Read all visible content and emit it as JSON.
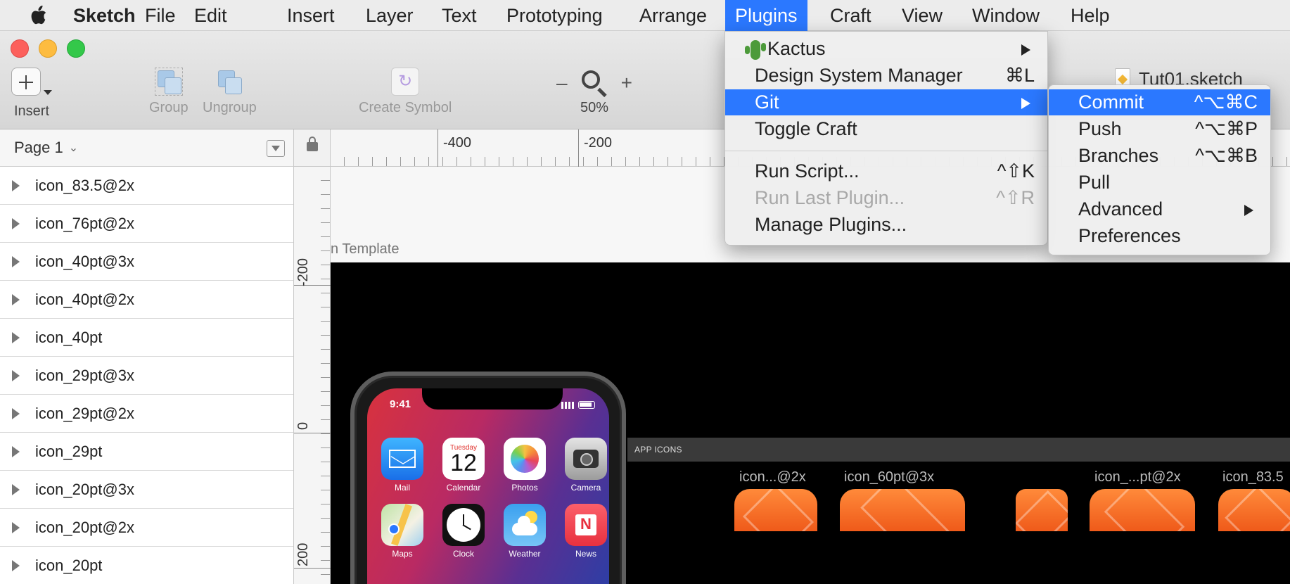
{
  "menubar": {
    "app_name": "Sketch",
    "items": [
      "File",
      "Edit",
      "Insert",
      "Layer",
      "Text",
      "Prototyping",
      "Arrange",
      "Plugins",
      "Craft",
      "View",
      "Window",
      "Help"
    ],
    "active_item": "Plugins"
  },
  "window": {
    "document_title": "Tut01.sketch"
  },
  "toolbar": {
    "insert_label": "Insert",
    "group_label": "Group",
    "ungroup_label": "Ungroup",
    "create_symbol_label": "Create Symbol",
    "zoom_minus": "–",
    "zoom_plus": "+",
    "zoom_level": "50%"
  },
  "sidebar": {
    "page_name": "Page 1",
    "layers": [
      "icon_83.5@2x",
      "icon_76pt@2x",
      "icon_40pt@3x",
      "icon_40pt@2x",
      "icon_40pt",
      "icon_29pt@3x",
      "icon_29pt@2x",
      "icon_29pt",
      "icon_20pt@3x",
      "icon_20pt@2x",
      "icon_20pt"
    ]
  },
  "rulers": {
    "horizontal_labels": [
      "-400",
      "-200"
    ],
    "vertical_labels": [
      "-200",
      "0",
      "200"
    ]
  },
  "canvas": {
    "artboard_title": "n Template",
    "phone": {
      "time": "9:41",
      "apps": [
        {
          "name": "Mail",
          "icon": "mail-icon"
        },
        {
          "name": "Calendar",
          "icon": "calendar-icon",
          "weekday": "Tuesday",
          "day": "12"
        },
        {
          "name": "Photos",
          "icon": "photos-icon"
        },
        {
          "name": "Camera",
          "icon": "camera-icon"
        },
        {
          "name": "Maps",
          "icon": "maps-icon"
        },
        {
          "name": "Clock",
          "icon": "clock-icon"
        },
        {
          "name": "Weather",
          "icon": "weather-icon"
        },
        {
          "name": "News",
          "icon": "news-icon"
        }
      ]
    },
    "app_icons_group_label": "APP ICONS",
    "app_icon_labels": [
      "icon...@2x",
      "icon_60pt@3x",
      "icon_...pt@2x",
      "icon_83.5"
    ]
  },
  "plugins_menu": {
    "items": [
      {
        "label": "Kactus",
        "shortcut": "",
        "submenu": true
      },
      {
        "label": "Design System Manager",
        "shortcut": "⌘L",
        "submenu": false
      },
      {
        "label": "Git",
        "shortcut": "",
        "submenu": true,
        "highlighted": true
      },
      {
        "label": "Toggle Craft",
        "shortcut": "",
        "submenu": false
      },
      {
        "label": "Run Script...",
        "shortcut": "^⇧K",
        "submenu": false
      },
      {
        "label": "Run Last Plugin...",
        "shortcut": "^⇧R",
        "submenu": false,
        "disabled": true
      },
      {
        "label": "Manage Plugins...",
        "shortcut": "",
        "submenu": false
      }
    ]
  },
  "git_submenu": {
    "items": [
      {
        "label": "Commit",
        "shortcut": "^⌥⌘C",
        "highlighted": true
      },
      {
        "label": "Push",
        "shortcut": "^⌥⌘P"
      },
      {
        "label": "Branches",
        "shortcut": "^⌥⌘B"
      },
      {
        "label": "Pull",
        "shortcut": ""
      },
      {
        "label": "Advanced",
        "shortcut": "",
        "submenu": true
      },
      {
        "label": "Preferences",
        "shortcut": ""
      }
    ]
  },
  "colors": {
    "menu_highlight": "#2b78ff",
    "icon_orange": "#ef5a1a"
  }
}
